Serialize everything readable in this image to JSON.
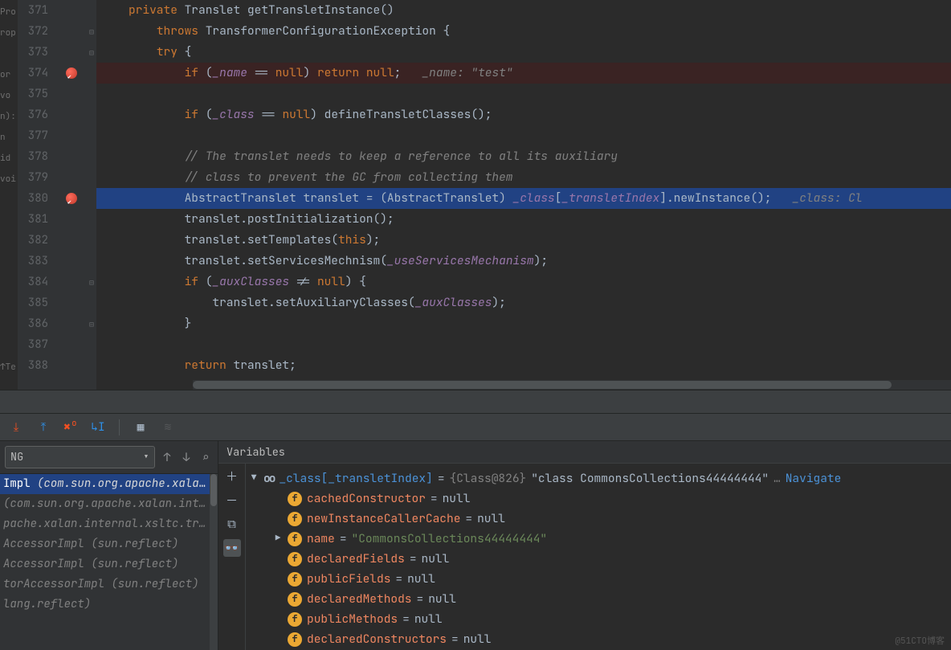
{
  "left_strip": "Pro\nrop\n\nor\nvo\nn):\nn\nid\nvoi\n\n\n\n\n\n\n\n\n↑Te\n",
  "editor": {
    "lines": [
      {
        "n": "371",
        "bp": false
      },
      {
        "n": "372",
        "bp": false
      },
      {
        "n": "373",
        "bp": false
      },
      {
        "n": "374",
        "bp": true
      },
      {
        "n": "375",
        "bp": false
      },
      {
        "n": "376",
        "bp": false
      },
      {
        "n": "377",
        "bp": false
      },
      {
        "n": "378",
        "bp": false
      },
      {
        "n": "379",
        "bp": false
      },
      {
        "n": "380",
        "bp": true
      },
      {
        "n": "381",
        "bp": false
      },
      {
        "n": "382",
        "bp": false
      },
      {
        "n": "383",
        "bp": false
      },
      {
        "n": "384",
        "bp": false
      },
      {
        "n": "385",
        "bp": false
      },
      {
        "n": "386",
        "bp": false
      },
      {
        "n": "387",
        "bp": false
      },
      {
        "n": "388",
        "bp": false
      }
    ],
    "t371_priv": "private",
    "t371_type": "Translet",
    "t371_name": "getTransletInstance",
    "t371_paren": "()",
    "t372_throws": "throws",
    "t372_ex": "TransformerConfigurationException {",
    "t373_try": "try",
    "t373_brace": "{",
    "t374_if": "if",
    "t374_open": " (",
    "t374_name": "_name",
    "t374_eq": " == ",
    "t374_null": "null",
    "t374_close": ") ",
    "t374_ret": "return",
    "t374_null2": "null",
    "t374_sc": ";   ",
    "t374_inlay": "_name: \"test\"",
    "t376_if": "if",
    "t376_open": " (",
    "t376_class": "_class",
    "t376_eq": " == ",
    "t376_null": "null",
    "t376_close": ") defineTransletClasses();",
    "t378_c": "// The translet needs to keep a reference to all its auxiliary",
    "t379_c": "// class to prevent the GC from collecting them",
    "t380_a": "AbstractTranslet translet = (AbstractTranslet) ",
    "t380_cls": "_class",
    "t380_br": "[",
    "t380_idx": "_transletIndex",
    "t380_br2": "]",
    "t380_b": ".newInstance();   ",
    "t380_inlay": "_class: Cl",
    "t381": "translet.postInitialization();",
    "t382_a": "translet.setTemplates(",
    "t382_this": "this",
    "t382_b": ");",
    "t383_a": "translet.setServicesMechnism(",
    "t383_f": "_useServicesMechanism",
    "t383_b": ");",
    "t384_if": "if",
    "t384_open": " (",
    "t384_aux": "_auxClasses",
    "t384_ne": " != ",
    "t384_null": "null",
    "t384_close": ") {",
    "t385_a": "    translet.setAuxiliaryClasses(",
    "t385_f": "_auxClasses",
    "t385_b": ");",
    "t386": "}",
    "t388_ret": "return",
    "t388_b": " translet;"
  },
  "frames": {
    "thread": "NG",
    "rows": [
      {
        "sel": true,
        "m": "Impl",
        "pkg": "(com.sun.org.apache.xalan.int"
      },
      {
        "sel": false,
        "m": "",
        "pkg": "(com.sun.org.apache.xalan.interna"
      },
      {
        "sel": false,
        "m": "",
        "pkg": "pache.xalan.internal.xsltc.trax)"
      },
      {
        "sel": false,
        "m": "",
        "pkg": "AccessorImpl (sun.reflect)"
      },
      {
        "sel": false,
        "m": "",
        "pkg": "AccessorImpl (sun.reflect)"
      },
      {
        "sel": false,
        "m": "",
        "pkg": "torAccessorImpl (sun.reflect)"
      },
      {
        "sel": false,
        "m": "",
        "pkg": "lang.reflect)"
      }
    ]
  },
  "variables": {
    "header": "Variables",
    "root_name": "_class[_transletIndex]",
    "root_eq": " = ",
    "root_obj": "{Class@826}",
    "root_str": " \"class CommonsCollections44444444\" ",
    "root_ell": "… ",
    "root_nav": "Navigate",
    "fields": [
      {
        "name": "cachedConstructor",
        "val": "null",
        "type": "null"
      },
      {
        "name": "newInstanceCallerCache",
        "val": "null",
        "type": "null"
      },
      {
        "name": "name",
        "val": "\"CommonsCollections44444444\"",
        "type": "str",
        "expand": true
      },
      {
        "name": "declaredFields",
        "val": "null",
        "type": "null"
      },
      {
        "name": "publicFields",
        "val": "null",
        "type": "null"
      },
      {
        "name": "declaredMethods",
        "val": "null",
        "type": "null"
      },
      {
        "name": "publicMethods",
        "val": "null",
        "type": "null"
      },
      {
        "name": "declaredConstructors",
        "val": "null",
        "type": "null"
      }
    ]
  },
  "watermark": "@51CTO博客"
}
